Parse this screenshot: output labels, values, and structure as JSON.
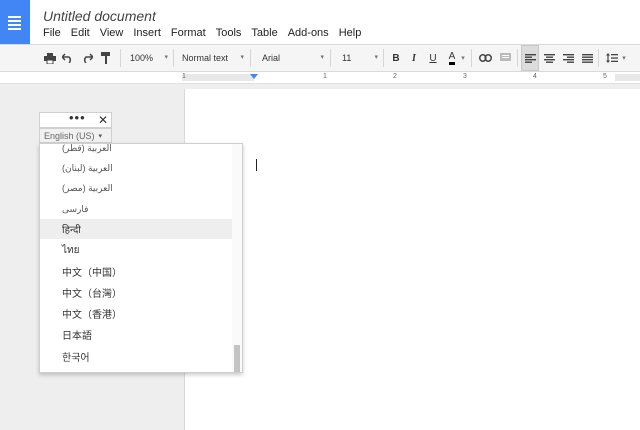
{
  "header": {
    "doc_title": "Untitled document",
    "menu": [
      "File",
      "Edit",
      "View",
      "Insert",
      "Format",
      "Tools",
      "Table",
      "Add-ons",
      "Help"
    ]
  },
  "toolbar": {
    "zoom": "100%",
    "style": "Normal text",
    "font": "Arial",
    "size": "11",
    "bold": "B",
    "italic": "I",
    "underline": "U",
    "text_color": "A",
    "accent_color": "#4285f4"
  },
  "ruler": {
    "numbers": [
      "1",
      "1",
      "2",
      "3",
      "4",
      "5"
    ]
  },
  "input_tools": {
    "more_label": "•••",
    "close_label": "✕",
    "language": "English (US)",
    "arrow": "▾"
  },
  "languages": [
    "العربية (قطر)",
    "العربية (لبنان)",
    "العربية (مصر)",
    "فارسی",
    "हिन्दी",
    "ไทย",
    "中文（中国）",
    "中文（台灣）",
    "中文（香港）",
    "日本語",
    "한국어"
  ],
  "highlighted_language": "हिन्दी"
}
